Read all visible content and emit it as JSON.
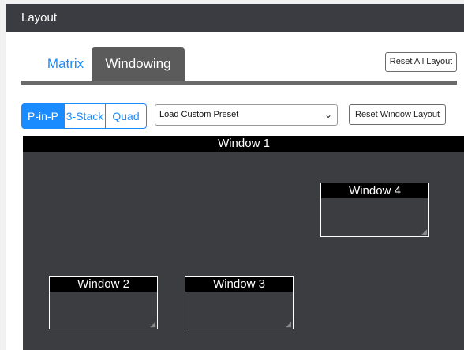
{
  "header": {
    "title": "Layout"
  },
  "tabs": [
    {
      "label": "Matrix",
      "active": false
    },
    {
      "label": "Windowing",
      "active": true
    }
  ],
  "toolbar": {
    "reset_all_label": "Reset All Layout",
    "reset_window_label": "Reset Window Layout",
    "modes": [
      {
        "label": "P-in-P",
        "selected": true
      },
      {
        "label": "3-Stack",
        "selected": false
      },
      {
        "label": "Quad",
        "selected": false
      }
    ],
    "preset_select": {
      "value": "Load Custom Preset"
    }
  },
  "canvas": {
    "main_window_label": "Window 1",
    "windows": [
      {
        "label": "Window 4"
      },
      {
        "label": "Window 2"
      },
      {
        "label": "Window 3"
      }
    ]
  },
  "colors": {
    "header_bg": "#3a3c42",
    "accent": "#1a8cff",
    "active_tab_bg": "#5b5b5b",
    "canvas_bg": "#3c3d41"
  },
  "icons": {
    "select_chevron": "chevron-down-icon",
    "resize_grip": "resize-grip-icon"
  }
}
